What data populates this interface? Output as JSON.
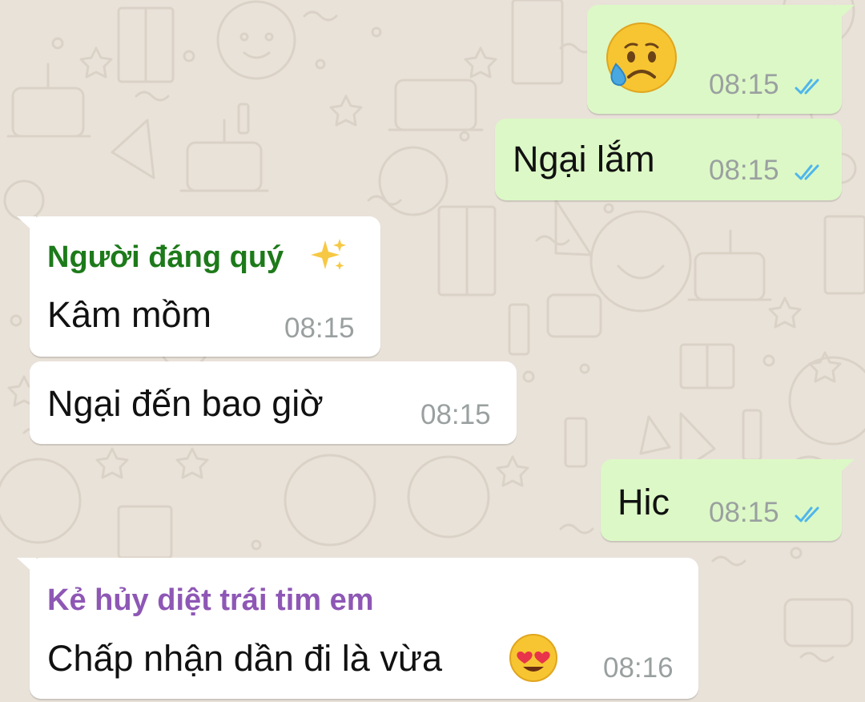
{
  "chat": {
    "messages": [
      {
        "direction": "outgoing",
        "emoji": "sad-relieved-face-emoji",
        "time": "08:15",
        "status": "read"
      },
      {
        "direction": "outgoing",
        "text": "Ngại lắm",
        "time": "08:15",
        "status": "read"
      },
      {
        "direction": "incoming",
        "sender": "Người đáng quý",
        "sender_emoji": "sparkles-emoji",
        "text": "Kâm mồm",
        "time": "08:15"
      },
      {
        "direction": "incoming",
        "text": "Ngại đến bao giờ",
        "time": "08:15"
      },
      {
        "direction": "outgoing",
        "text": "Hic",
        "time": "08:15",
        "status": "read"
      },
      {
        "direction": "incoming",
        "sender": "Kẻ hủy diệt trái tim em",
        "text": "Chấp nhận dần đi là vừa",
        "text_emoji": "heart-eyes-emoji",
        "time": "08:16"
      }
    ]
  },
  "colors": {
    "wallpaper": "#e9e2d9",
    "outgoing_bubble": "#dcf8c6",
    "incoming_bubble": "#ffffff",
    "sender_1": "#1d7a1a",
    "sender_2": "#8e57b5",
    "read_ticks": "#4fb6ec",
    "timestamp": "#9aa0a0"
  }
}
